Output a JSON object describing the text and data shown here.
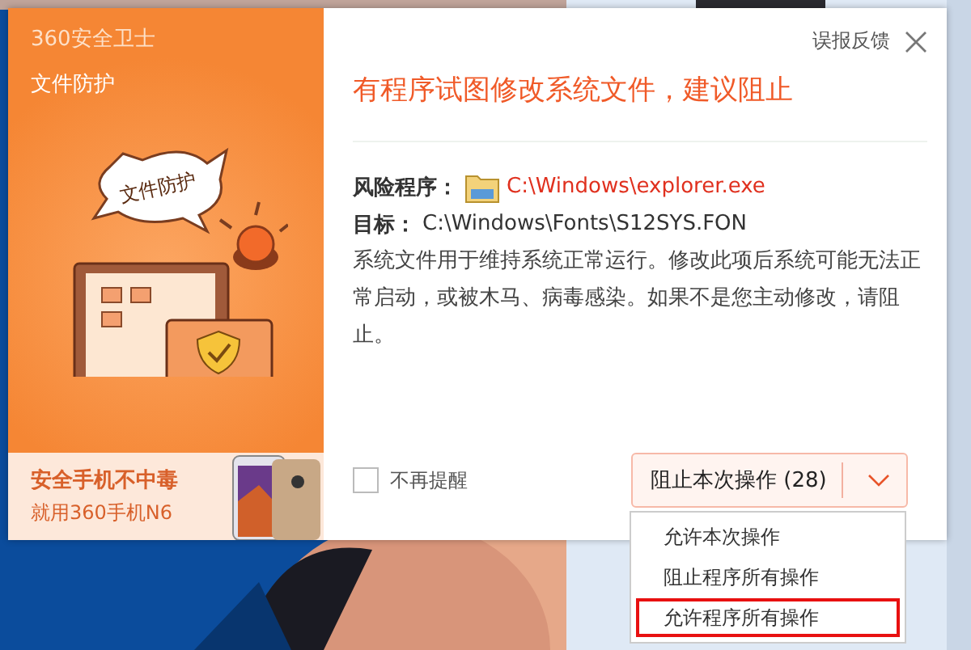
{
  "sidebar": {
    "brand": "360安全卫士",
    "title": "文件防护",
    "bubble": "文件防护",
    "ad": [
      "安全手机不中毒",
      "就用360手机N6"
    ]
  },
  "feedback": "误报反馈",
  "headline": "有程序试图修改系统文件，建议阻止",
  "details": [
    {
      "kind": "program",
      "label": "风险程序：",
      "value": "C:\\Windows\\explorer.exe"
    },
    {
      "kind": "target",
      "label": "目标：",
      "value": "C:\\Windows\\Fonts\\S12SYS.FON"
    }
  ],
  "description": "系统文件用于维持系统正常运行。修改此项后系统可能无法正常启动，或被木马、病毒感染。如果不是您主动修改，请阻止。",
  "remind": {
    "label": "不再提醒",
    "checked": false
  },
  "action_button": {
    "label": "阻止本次操作 (28)"
  },
  "menu": {
    "expanded": true,
    "items": [
      {
        "label": "允许本次操作",
        "selected": false
      },
      {
        "label": "阻止程序所有操作",
        "selected": false
      },
      {
        "label": "允许程序所有操作",
        "selected": true
      }
    ]
  }
}
